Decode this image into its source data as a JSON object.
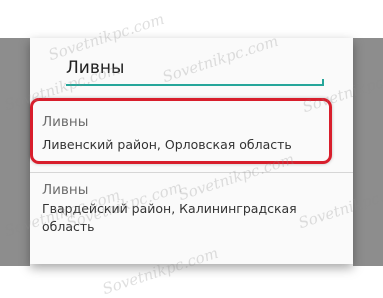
{
  "search": {
    "value": "Ливны"
  },
  "results": [
    {
      "title": "Ливны",
      "subtitle": "Ливенский район, Орловская область"
    },
    {
      "title": "Ливны",
      "subtitle": "Гвардейский район, Калининградская область"
    }
  ],
  "watermark": "Sovetnikpc.com",
  "colors": {
    "accent_underline": "#26a69a",
    "highlight_border": "#d81e2c",
    "overlay": "#8d8d8d",
    "dialog_bg": "#fafafa"
  }
}
